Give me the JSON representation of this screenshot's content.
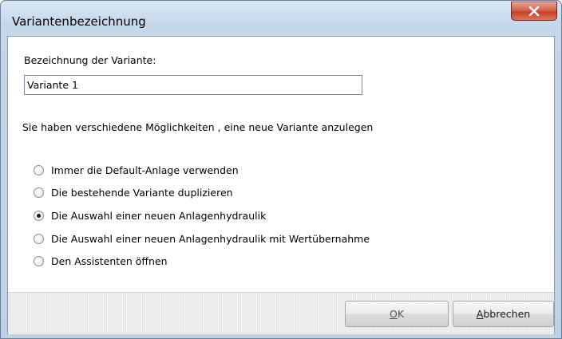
{
  "window": {
    "title": "Variantenbezeichnung",
    "close_icon": "close-icon"
  },
  "form": {
    "name_label": "Bezeichnung der Variante:",
    "name_value": "Variante 1",
    "intro_text": "Sie haben verschiedene Möglichkeiten , eine neue Variante anzulegen"
  },
  "options": [
    {
      "label": "Immer die Default-Anlage verwenden",
      "checked": false
    },
    {
      "label": "Die bestehende Variante duplizieren",
      "checked": false
    },
    {
      "label": "Die Auswahl einer neuen Anlagenhydraulik",
      "checked": true
    },
    {
      "label": "Die Auswahl einer neuen Anlagenhydraulik mit Wertübernahme",
      "checked": false
    },
    {
      "label": "Den Assistenten öffnen",
      "checked": false
    }
  ],
  "buttons": {
    "ok_mnemonic": "O",
    "ok_rest": "K",
    "cancel_mnemonic": "A",
    "cancel_rest": "bbrechen"
  },
  "colors": {
    "title_bar": "#c6d7ea",
    "close_button": "#c4412a",
    "button_bar": "#eeeeee"
  }
}
